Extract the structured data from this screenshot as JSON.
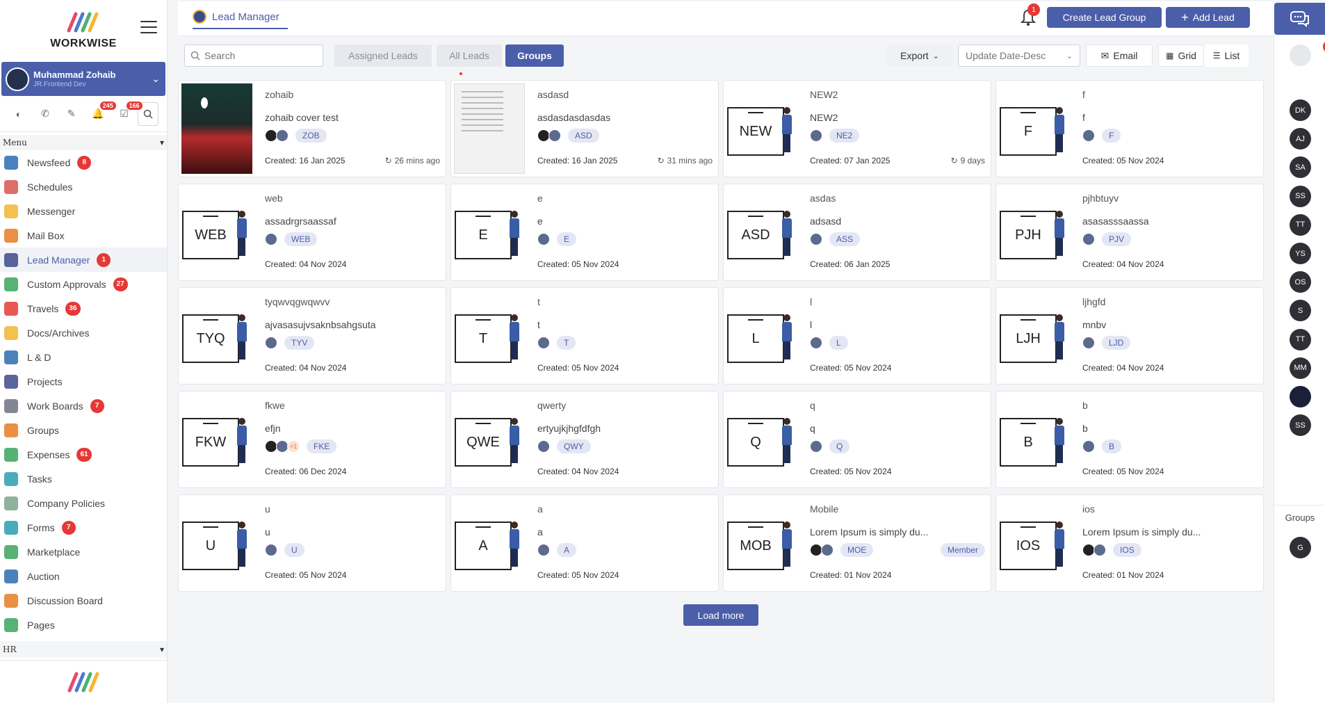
{
  "app": {
    "name": "WORKWISE"
  },
  "user": {
    "name": "Muhammad Zohaib",
    "role": "JR.Frontend Dev"
  },
  "quick_badges": {
    "notifications": "245",
    "approvals": "166"
  },
  "menu": {
    "header": "Menu",
    "items": [
      {
        "label": "Newsfeed",
        "badge": "8",
        "icon": "newsfeed-icon",
        "color": "#2b6cb0"
      },
      {
        "label": "Schedules",
        "badge": "",
        "icon": "schedules-icon",
        "color": "#d9534f"
      },
      {
        "label": "Messenger",
        "badge": "",
        "icon": "messenger-icon",
        "color": "#f2b632"
      },
      {
        "label": "Mail Box",
        "badge": "",
        "icon": "mailbox-icon",
        "color": "#e57c23"
      },
      {
        "label": "Lead Manager",
        "badge": "1",
        "icon": "lead-manager-icon",
        "color": "#3c4a8a"
      },
      {
        "label": "Custom Approvals",
        "badge": "27",
        "icon": "custom-approvals-icon",
        "color": "#3aa55d"
      },
      {
        "label": "Travels",
        "badge": "36",
        "icon": "travels-icon",
        "color": "#e53935"
      },
      {
        "label": "Docs/Archives",
        "badge": "",
        "icon": "docs-archives-icon",
        "color": "#f2b632"
      },
      {
        "label": "L & D",
        "badge": "",
        "icon": "learning-icon",
        "color": "#2b6cb0"
      },
      {
        "label": "Projects",
        "badge": "",
        "icon": "projects-icon",
        "color": "#3c4a8a"
      },
      {
        "label": "Work Boards",
        "badge": "7",
        "icon": "work-boards-icon",
        "color": "#6b7280"
      },
      {
        "label": "Groups",
        "badge": "",
        "icon": "groups-icon",
        "color": "#e57c23"
      },
      {
        "label": "Expenses",
        "badge": "61",
        "icon": "expenses-icon",
        "color": "#3aa55d"
      },
      {
        "label": "Tasks",
        "badge": "",
        "icon": "tasks-icon",
        "color": "#2b9cb0"
      },
      {
        "label": "Company Policies",
        "badge": "",
        "icon": "company-policies-icon",
        "color": "#7aa58a"
      },
      {
        "label": "Forms",
        "badge": "7",
        "icon": "forms-icon",
        "color": "#2b9cb0"
      },
      {
        "label": "Marketplace",
        "badge": "",
        "icon": "marketplace-icon",
        "color": "#3aa55d"
      },
      {
        "label": "Auction",
        "badge": "",
        "icon": "auction-icon",
        "color": "#2b6cb0"
      },
      {
        "label": "Discussion Board",
        "badge": "",
        "icon": "discussion-board-icon",
        "color": "#e57c23"
      },
      {
        "label": "Pages",
        "badge": "",
        "icon": "pages-icon",
        "color": "#3aa55d"
      }
    ],
    "hr_label": "HR"
  },
  "topbar": {
    "title": "Lead Manager",
    "bell_count": "1",
    "create_group": "Create Lead Group",
    "add_lead": "Add Lead"
  },
  "filters": {
    "search_placeholder": "Search",
    "tabs": [
      "Assigned Leads",
      "All Leads",
      "Groups"
    ],
    "active_tab": "Groups",
    "export": "Export",
    "sort": "Update Date-Desc",
    "email": "Email",
    "grid": "Grid",
    "list": "List"
  },
  "cards": [
    {
      "name": "zohaib",
      "desc": "zohaib cover test",
      "code": "ZOB",
      "created": "Created: 16 Jan 2025",
      "ago": "26 mins ago",
      "thumb": "image-mountain",
      "member": ""
    },
    {
      "name": "asdasd",
      "desc": "asdasdasdasdas",
      "code": "ASD",
      "created": "Created: 16 Jan 2025",
      "ago": "31 mins ago",
      "thumb": "image-doc",
      "member": ""
    },
    {
      "name": "NEW2",
      "desc": "NEW2",
      "code": "NE2",
      "created": "Created: 07 Jan 2025",
      "ago": "9 days",
      "thumb": "NEW",
      "member": ""
    },
    {
      "name": "f",
      "desc": "f",
      "code": "F",
      "created": "Created: 05 Nov 2024",
      "ago": "",
      "thumb": "F",
      "member": ""
    },
    {
      "name": "web",
      "desc": "assadrgrsaassaf",
      "code": "WEB",
      "created": "Created: 04 Nov 2024",
      "ago": "",
      "thumb": "WEB",
      "member": ""
    },
    {
      "name": "e",
      "desc": "e",
      "code": "E",
      "created": "Created: 05 Nov 2024",
      "ago": "",
      "thumb": "E",
      "member": ""
    },
    {
      "name": "asdas",
      "desc": "adsasd",
      "code": "ASS",
      "created": "Created: 06 Jan 2025",
      "ago": "",
      "thumb": "ASD",
      "member": ""
    },
    {
      "name": "pjhbtuyv",
      "desc": "asasasssaassa",
      "code": "PJV",
      "created": "Created: 04 Nov 2024",
      "ago": "",
      "thumb": "PJH",
      "member": ""
    },
    {
      "name": "tyqwvqgwqwvv",
      "desc": "ajvasasujvsaknbsahgsuta",
      "code": "TYV",
      "created": "Created: 04 Nov 2024",
      "ago": "",
      "thumb": "TYQ",
      "member": ""
    },
    {
      "name": "t",
      "desc": "t",
      "code": "T",
      "created": "Created: 05 Nov 2024",
      "ago": "",
      "thumb": "T",
      "member": ""
    },
    {
      "name": "l",
      "desc": "l",
      "code": "L",
      "created": "Created: 05 Nov 2024",
      "ago": "",
      "thumb": "L",
      "member": ""
    },
    {
      "name": "ljhgfd",
      "desc": "mnbv",
      "code": "LJD",
      "created": "Created: 04 Nov 2024",
      "ago": "",
      "thumb": "LJH",
      "member": ""
    },
    {
      "name": "fkwe",
      "desc": "efjn",
      "code": "FKE",
      "created": "Created: 06 Dec 2024",
      "ago": "",
      "thumb": "FKW",
      "member": "",
      "extra": "+1"
    },
    {
      "name": "qwerty",
      "desc": "ertyujkjhgfdfgh",
      "code": "QWY",
      "created": "Created: 04 Nov 2024",
      "ago": "",
      "thumb": "QWE",
      "member": ""
    },
    {
      "name": "q",
      "desc": "q",
      "code": "Q",
      "created": "Created: 05 Nov 2024",
      "ago": "",
      "thumb": "Q",
      "member": ""
    },
    {
      "name": "b",
      "desc": "b",
      "code": "B",
      "created": "Created: 05 Nov 2024",
      "ago": "",
      "thumb": "B",
      "member": ""
    },
    {
      "name": "u",
      "desc": "u",
      "code": "U",
      "created": "Created: 05 Nov 2024",
      "ago": "",
      "thumb": "U",
      "member": ""
    },
    {
      "name": "a",
      "desc": "a",
      "code": "A",
      "created": "Created: 05 Nov 2024",
      "ago": "",
      "thumb": "A",
      "member": ""
    },
    {
      "name": "Mobile",
      "desc": "Lorem Ipsum is simply du...",
      "code": "MOE",
      "created": "Created: 01 Nov 2024",
      "ago": "",
      "thumb": "MOB",
      "member": "Member"
    },
    {
      "name": "ios",
      "desc": "Lorem Ipsum is simply du...",
      "code": "IOS",
      "created": "Created: 01 Nov 2024",
      "ago": "",
      "thumb": "IOS",
      "member": ""
    }
  ],
  "load_more": "Load more",
  "rail": {
    "top_badge": "2",
    "contacts": [
      "DK",
      "AJ",
      "SA",
      "SS",
      "TT",
      "YS",
      "OS",
      "S",
      "TT",
      "MM",
      "",
      "SS"
    ],
    "groups_label": "Groups",
    "groups": [
      "G"
    ]
  }
}
